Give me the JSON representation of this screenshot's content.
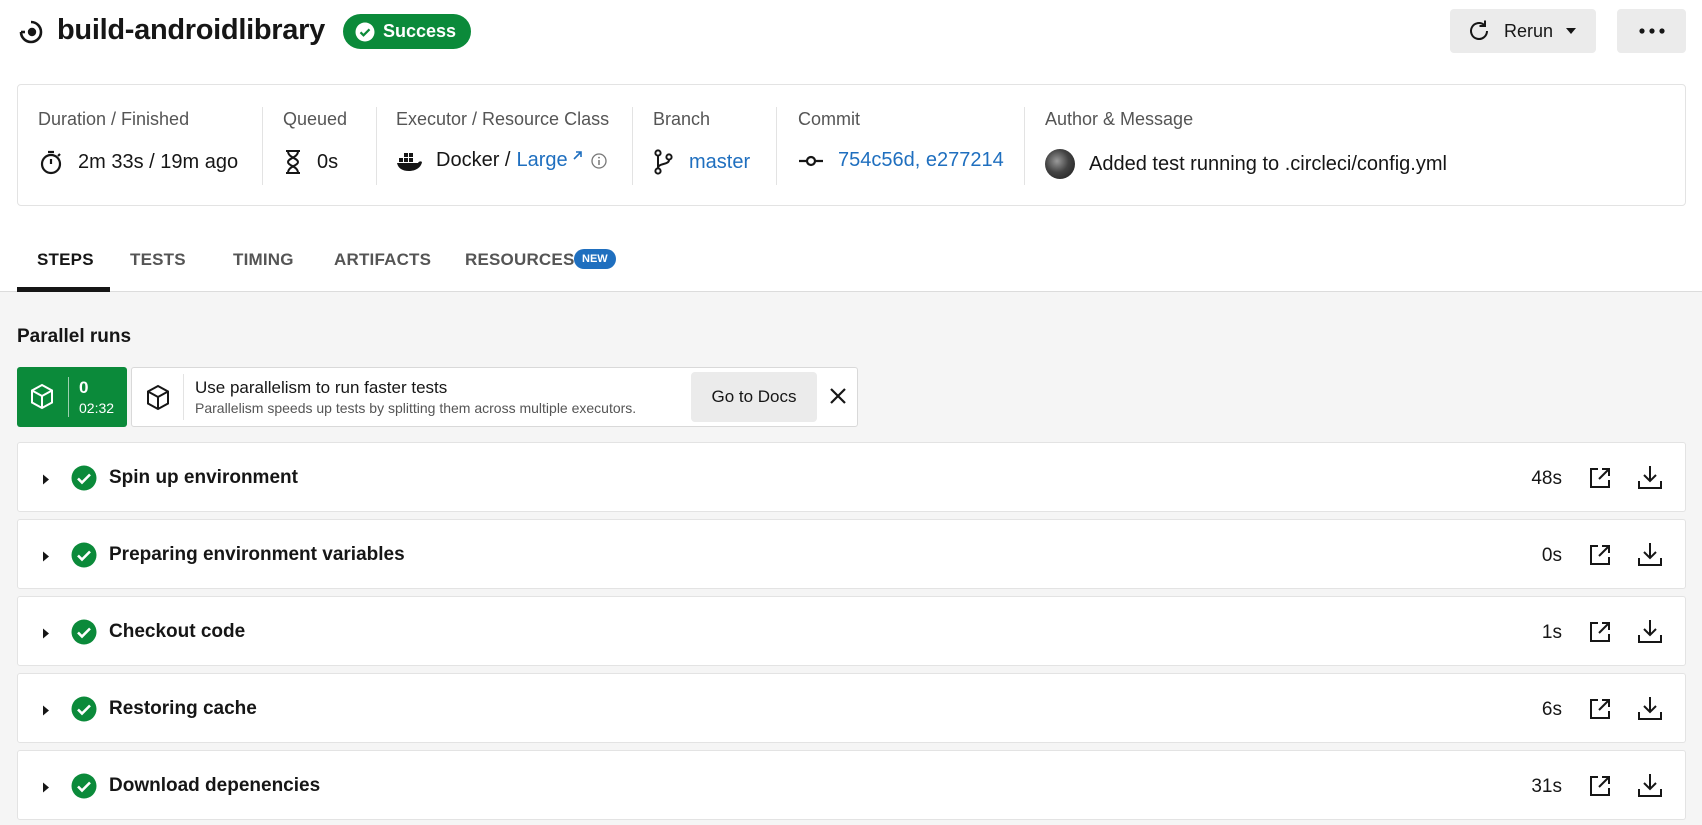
{
  "header": {
    "job_title": "build-androidlibrary",
    "status": "Success",
    "rerun_label": "Rerun",
    "colors": {
      "success": "#0b8a3a",
      "link": "#1f6fbf"
    }
  },
  "info": {
    "duration": {
      "label": "Duration / Finished",
      "value": "2m 33s / 19m ago"
    },
    "queued": {
      "label": "Queued",
      "value": "0s"
    },
    "executor": {
      "label": "Executor / Resource Class",
      "executor": "Docker /",
      "resource_class": "Large"
    },
    "branch": {
      "label": "Branch",
      "value": "master"
    },
    "commit": {
      "label": "Commit",
      "value": "754c56d, e277214"
    },
    "author": {
      "label": "Author & Message",
      "message": "Added test running to .circleci/config.yml"
    }
  },
  "tabs": [
    {
      "label": "STEPS",
      "active": true
    },
    {
      "label": "TESTS",
      "active": false
    },
    {
      "label": "TIMING",
      "active": false
    },
    {
      "label": "ARTIFACTS",
      "active": false
    },
    {
      "label": "RESOURCES",
      "active": false,
      "badge": "NEW"
    }
  ],
  "parallel": {
    "title": "Parallel runs",
    "run": {
      "index": "0",
      "time": "02:32"
    },
    "promo": {
      "title": "Use parallelism to run faster tests",
      "subtitle": "Parallelism speeds up tests by splitting them across multiple executors.",
      "button": "Go to Docs"
    }
  },
  "steps": [
    {
      "name": "Spin up environment",
      "duration": "48s"
    },
    {
      "name": "Preparing environment variables",
      "duration": "0s"
    },
    {
      "name": "Checkout code",
      "duration": "1s"
    },
    {
      "name": "Restoring cache",
      "duration": "6s"
    },
    {
      "name": "Download depenencies",
      "duration": "31s"
    }
  ]
}
